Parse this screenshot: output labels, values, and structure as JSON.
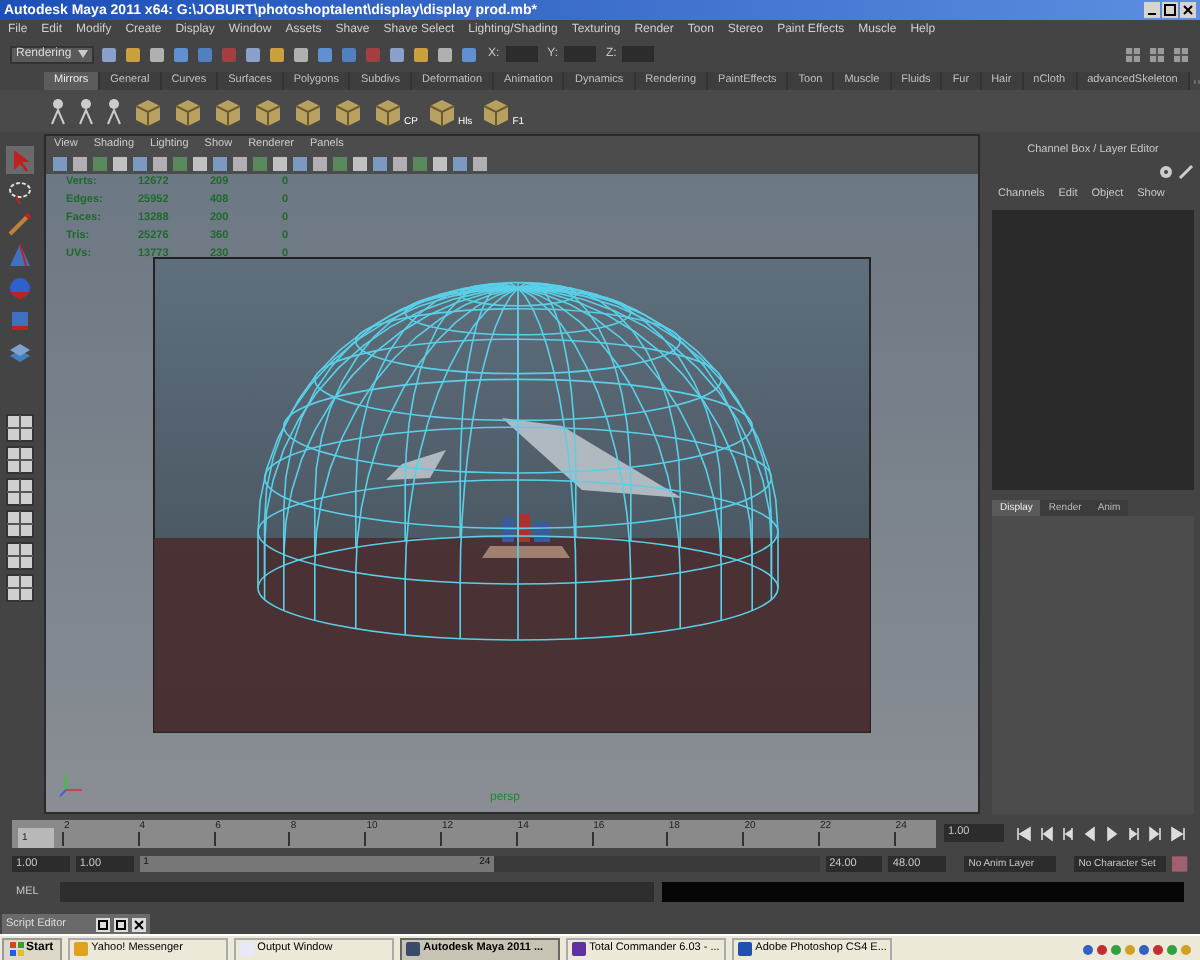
{
  "window": {
    "title": "Autodesk Maya 2011 x64: G:\\JOBURT\\photoshoptalent\\display\\display prod.mb*"
  },
  "menu": [
    "File",
    "Edit",
    "Modify",
    "Create",
    "Display",
    "Window",
    "Assets",
    "Shave",
    "Shave Select",
    "Lighting/Shading",
    "Texturing",
    "Render",
    "Toon",
    "Stereo",
    "Paint Effects",
    "Muscle",
    "Help"
  ],
  "status_line": {
    "mode": "Rendering",
    "x_label": "X:",
    "y_label": "Y:",
    "z_label": "Z:"
  },
  "shelf": {
    "tabs": [
      {
        "label": "Mirrors",
        "selected": true
      },
      {
        "label": "General",
        "selected": false
      },
      {
        "label": "Curves",
        "selected": false
      },
      {
        "label": "Surfaces",
        "selected": false
      },
      {
        "label": "Polygons",
        "selected": false
      },
      {
        "label": "Subdivs",
        "selected": false
      },
      {
        "label": "Deformation",
        "selected": false
      },
      {
        "label": "Animation",
        "selected": false
      },
      {
        "label": "Dynamics",
        "selected": false
      },
      {
        "label": "Rendering",
        "selected": false
      },
      {
        "label": "PaintEffects",
        "selected": false
      },
      {
        "label": "Toon",
        "selected": false
      },
      {
        "label": "Muscle",
        "selected": false
      },
      {
        "label": "Fluids",
        "selected": false
      },
      {
        "label": "Fur",
        "selected": false
      },
      {
        "label": "Hair",
        "selected": false
      },
      {
        "label": "nCloth",
        "selected": false
      },
      {
        "label": "advancedSkeleton",
        "selected": false
      }
    ],
    "items": [
      {
        "label": "CP"
      },
      {
        "label": "Hls"
      },
      {
        "label": "F1"
      }
    ]
  },
  "viewport": {
    "menu": [
      "View",
      "Shading",
      "Lighting",
      "Show",
      "Renderer",
      "Panels"
    ],
    "hud": [
      {
        "label": "Verts:",
        "values": [
          "12672",
          "209",
          "0"
        ]
      },
      {
        "label": "Edges:",
        "values": [
          "25952",
          "408",
          "0"
        ]
      },
      {
        "label": "Faces:",
        "values": [
          "13288",
          "200",
          "0"
        ]
      },
      {
        "label": "Tris:",
        "values": [
          "25276",
          "360",
          "0"
        ]
      },
      {
        "label": "UVs:",
        "values": [
          "13773",
          "230",
          "0"
        ]
      }
    ],
    "camera": "persp"
  },
  "channel_box": {
    "title": "Channel Box / Layer Editor",
    "menu": [
      "Channels",
      "Edit",
      "Object",
      "Show"
    ],
    "tabs": [
      {
        "label": "Display",
        "selected": true
      },
      {
        "label": "Render",
        "selected": false
      },
      {
        "label": "Anim",
        "selected": false
      }
    ]
  },
  "time_slider": {
    "level": 0,
    "current_frame": "1",
    "ticks": [
      "2",
      "4",
      "6",
      "8",
      "10",
      "12",
      "14",
      "16",
      "18",
      "20",
      "22",
      "24"
    ],
    "current_time": "1.00"
  },
  "range_slider": {
    "level": 0.5,
    "start": "1.00",
    "playback_start": "1.00",
    "range_start": "1",
    "range_end": "24",
    "playback_end": "24.00",
    "end": "48.00",
    "anim_layer": "No Anim Layer",
    "character_set": "No Character Set"
  },
  "command_line": {
    "label": "MEL"
  },
  "script_editor": {
    "title": "Script Editor"
  },
  "taskbar": {
    "start": "Start",
    "items": [
      {
        "label": "Yahoo! Messenger",
        "selected": false
      },
      {
        "label": "Output Window",
        "selected": false
      },
      {
        "label": "Autodesk Maya 2011 ...",
        "selected": true
      },
      {
        "label": "Total Commander 6.03 - ...",
        "selected": false
      },
      {
        "label": "Adobe Photoshop CS4 E...",
        "selected": false
      }
    ]
  }
}
